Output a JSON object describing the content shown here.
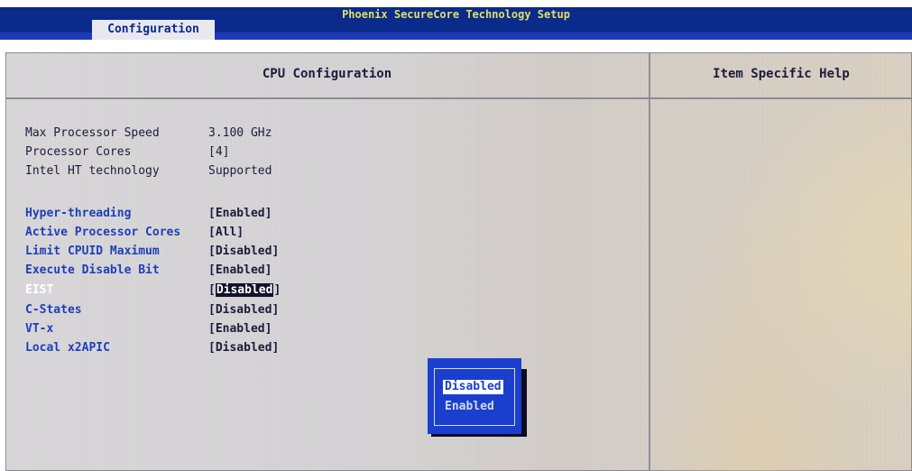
{
  "colors": {
    "title_bar": "#0a2a8c",
    "menu_line": "#1f39b8",
    "option_label": "#1f3fb8",
    "popup_bg": "#1a3fcf",
    "title_text": "#e0e060"
  },
  "window": {
    "title": "Phoenix SecureCore Technology Setup"
  },
  "menu": {
    "active_tab": "Configuration"
  },
  "panel": {
    "title": "CPU Configuration",
    "help_title": "Item Specific Help"
  },
  "info": [
    {
      "label": "Max Processor Speed",
      "value": "3.100 GHz"
    },
    {
      "label": "Processor Cores",
      "value": "[4]"
    },
    {
      "label": "Intel HT technology",
      "value": "Supported"
    }
  ],
  "options": [
    {
      "label": "Hyper-threading",
      "value": "[Enabled]"
    },
    {
      "label": "Active Processor Cores",
      "value": "[All]"
    },
    {
      "label": "Limit CPUID Maximum",
      "value": "[Disabled]"
    },
    {
      "label": "Execute Disable Bit",
      "value": "[Enabled]"
    },
    {
      "label": "EIST",
      "value": "Disabled",
      "bracket_open": "[",
      "bracket_close": "]",
      "selected": true
    },
    {
      "label": "C-States",
      "value": "[Disabled]"
    },
    {
      "label": "VT-x",
      "value": "[Enabled]"
    },
    {
      "label": "Local x2APIC",
      "value": "[Disabled]"
    }
  ],
  "popup": {
    "items": [
      "Disabled",
      "Enabled"
    ],
    "highlighted": "Disabled"
  }
}
